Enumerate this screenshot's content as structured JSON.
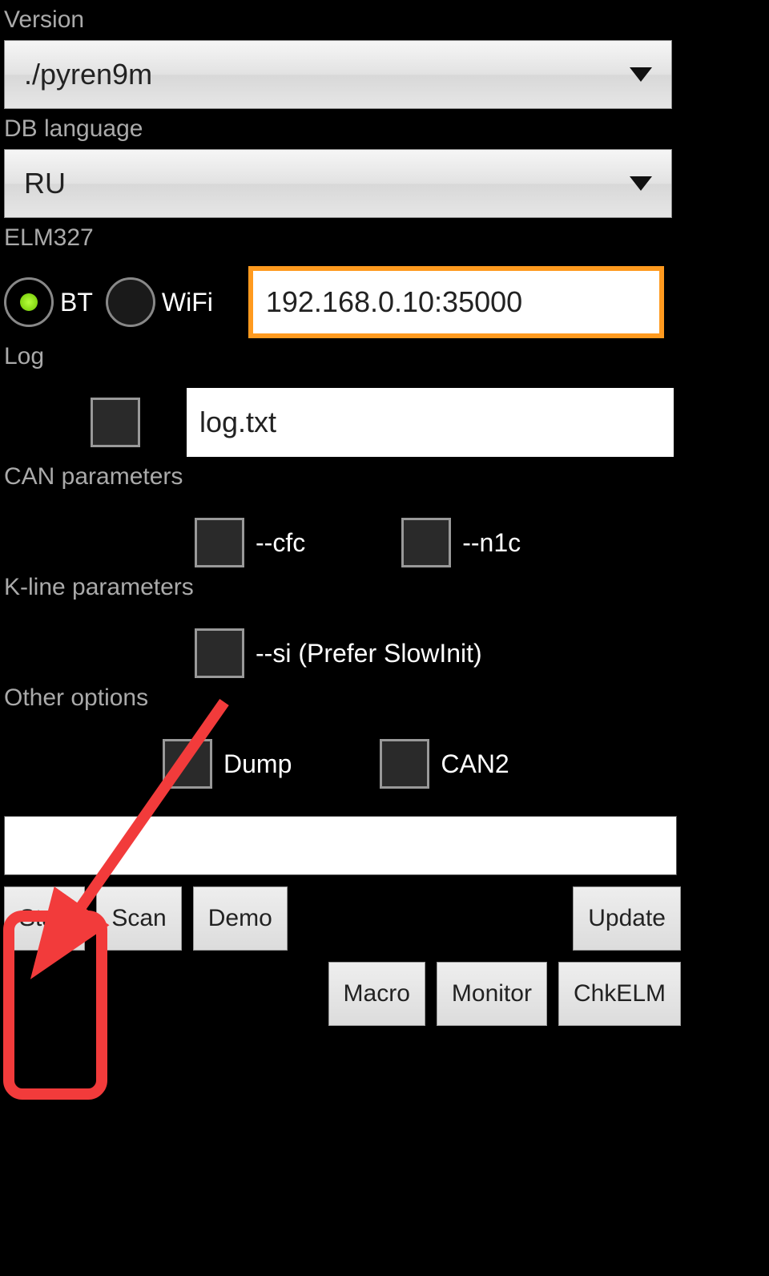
{
  "version": {
    "label": "Version",
    "selected": "./pyren9m"
  },
  "db_language": {
    "label": "DB language",
    "selected": "RU"
  },
  "elm327": {
    "label": "ELM327",
    "bt_label": "BT",
    "wifi_label": "WiFi",
    "address": "192.168.0.10:35000"
  },
  "log": {
    "label": "Log",
    "file": "log.txt"
  },
  "can": {
    "label": "CAN parameters",
    "cfc_label": "--cfc",
    "n1c_label": "--n1c"
  },
  "kline": {
    "label": "K-line parameters",
    "si_label": "--si (Prefer SlowInit)"
  },
  "other": {
    "label": "Other options",
    "dump_label": "Dump",
    "can2_label": "CAN2"
  },
  "buttons": {
    "start": "Start",
    "scan": "Scan",
    "demo": "Demo",
    "update": "Update",
    "macro": "Macro",
    "monitor": "Monitor",
    "chkelm": "ChkELM"
  }
}
